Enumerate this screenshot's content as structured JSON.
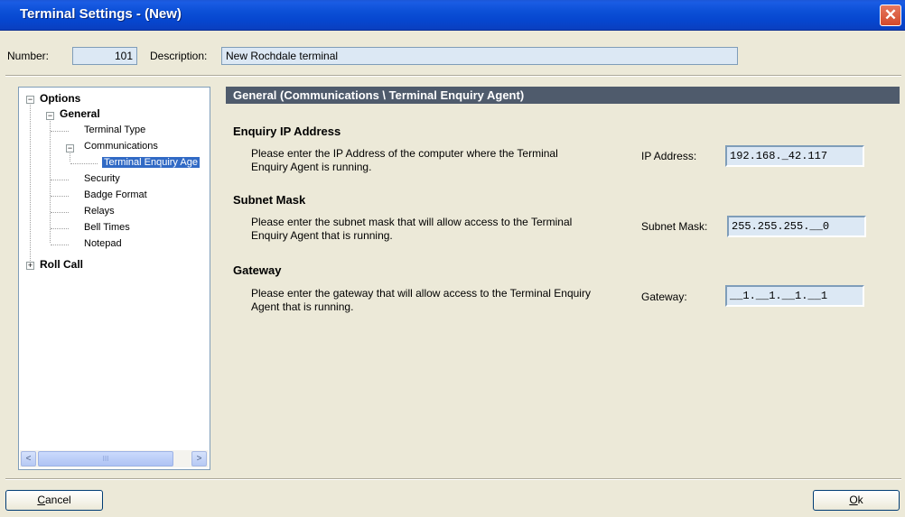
{
  "window": {
    "title": "Terminal Settings - (New)",
    "close_glyph": "✕"
  },
  "header": {
    "number_label": "Number:",
    "number_value": "101",
    "description_label": "Description:",
    "description_value": "New Rochdale terminal"
  },
  "tree": {
    "options": "Options",
    "general": "General",
    "terminal_type": "Terminal Type",
    "communications": "Communications",
    "terminal_enquiry_agent": "Terminal Enquiry Age",
    "security": "Security",
    "badge_format": "Badge Format",
    "relays": "Relays",
    "bell_times": "Bell Times",
    "notepad": "Notepad",
    "roll_call": "Roll Call",
    "scroll_left": "<",
    "scroll_right": ">",
    "thumb_grip": "III"
  },
  "panel": {
    "header": "General (Communications \\ Terminal Enquiry Agent)",
    "enquiry": {
      "title": "Enquiry IP Address",
      "description": "Please enter the IP Address of the computer where the Terminal Enquiry Agent is running.",
      "label": "IP Address:",
      "value": "192.168._42.117"
    },
    "subnet": {
      "title": "Subnet Mask",
      "description": "Please enter the subnet mask that will allow access to the Terminal Enquiry Agent that is running.",
      "label": "Subnet Mask:",
      "value": "255.255.255.__0"
    },
    "gateway": {
      "title": "Gateway",
      "description": "Please enter the gateway that will allow access to the Terminal Enquiry Agent that is running.",
      "label": "Gateway:",
      "value": "__1.__1.__1.__1"
    }
  },
  "buttons": {
    "cancel": "Cancel",
    "ok": "Ok"
  },
  "colors": {
    "titlebar": "#0b4fd6",
    "selection": "#316ac5",
    "section_header": "#4f5b6c",
    "field_bg": "#dce8f4"
  }
}
